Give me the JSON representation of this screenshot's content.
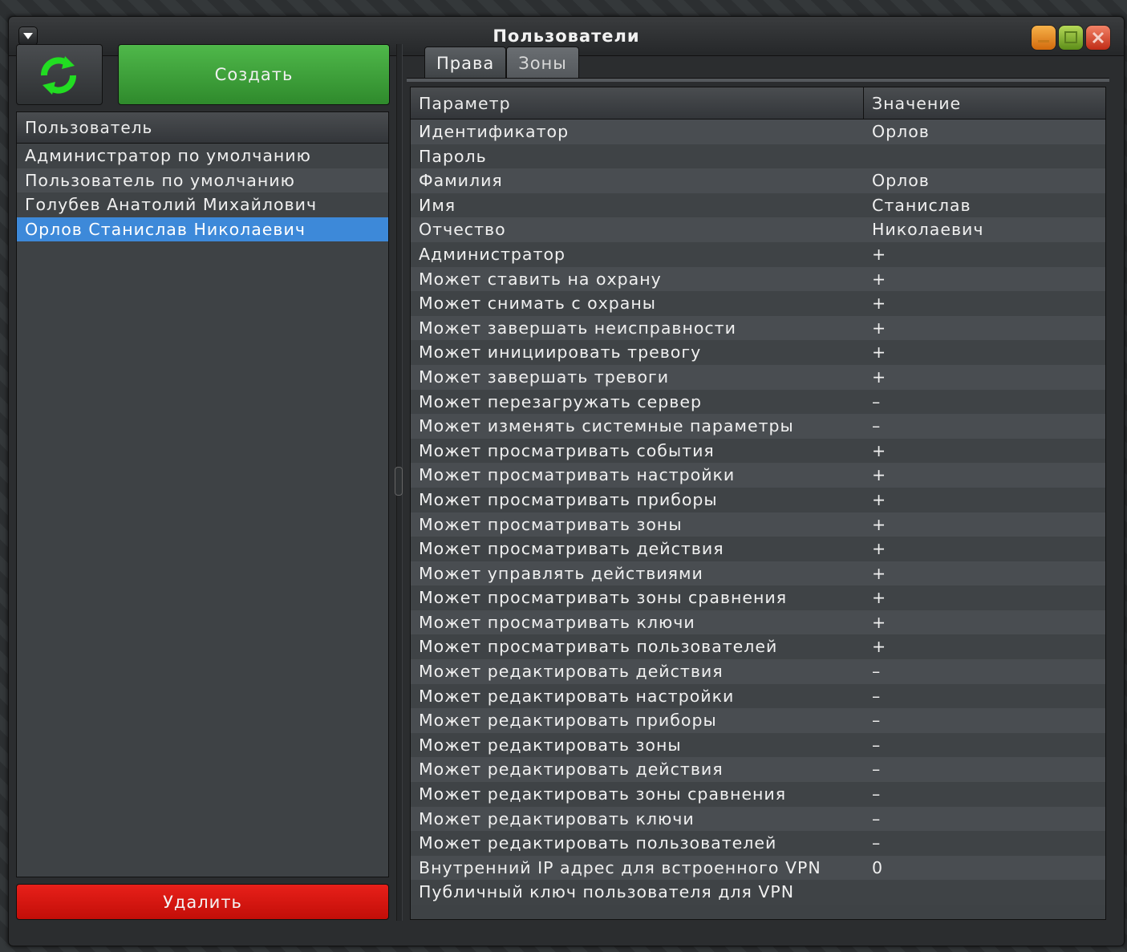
{
  "window": {
    "title": "Пользователи"
  },
  "left": {
    "create_label": "Создать",
    "delete_label": "Удалить",
    "list_header": "Пользователь",
    "users": [
      {
        "name": "Администратор по умолчанию",
        "selected": false
      },
      {
        "name": "Пользователь по умолчанию",
        "selected": false
      },
      {
        "name": "Голубев Анатолий Михайлович",
        "selected": false
      },
      {
        "name": "Орлов Станислав Николаевич",
        "selected": true
      }
    ]
  },
  "right": {
    "tabs": [
      {
        "label": "Права",
        "active": true
      },
      {
        "label": "Зоны",
        "active": false
      }
    ],
    "table": {
      "header_param": "Параметр",
      "header_value": "Значение",
      "rows": [
        {
          "param": "Идентификатор",
          "value": "Орлов"
        },
        {
          "param": "Пароль",
          "value": ""
        },
        {
          "param": "Фамилия",
          "value": "Орлов"
        },
        {
          "param": "Имя",
          "value": "Станислав"
        },
        {
          "param": "Отчество",
          "value": "Николаевич"
        },
        {
          "param": "Администратор",
          "value": "+"
        },
        {
          "param": "Может ставить на охрану",
          "value": "+"
        },
        {
          "param": "Может снимать с охраны",
          "value": "+"
        },
        {
          "param": "Может завершать неисправности",
          "value": "+"
        },
        {
          "param": "Может инициировать тревогу",
          "value": "+"
        },
        {
          "param": "Может завершать тревоги",
          "value": "+"
        },
        {
          "param": "Может перезагружать сервер",
          "value": "–"
        },
        {
          "param": "Может изменять системные параметры",
          "value": "–"
        },
        {
          "param": "Может просматривать события",
          "value": "+"
        },
        {
          "param": "Может просматривать настройки",
          "value": "+"
        },
        {
          "param": "Может просматривать приборы",
          "value": "+"
        },
        {
          "param": "Может просматривать зоны",
          "value": "+"
        },
        {
          "param": "Может просматривать действия",
          "value": "+"
        },
        {
          "param": "Может управлять действиями",
          "value": "+"
        },
        {
          "param": "Может просматривать зоны сравнения",
          "value": "+"
        },
        {
          "param": "Может просматривать ключи",
          "value": "+"
        },
        {
          "param": "Может просматривать пользователей",
          "value": "+"
        },
        {
          "param": "Может редактировать действия",
          "value": "–"
        },
        {
          "param": "Может редактировать настройки",
          "value": "–"
        },
        {
          "param": "Может редактировать приборы",
          "value": "–"
        },
        {
          "param": "Может редактировать зоны",
          "value": "–"
        },
        {
          "param": "Может редактировать действия",
          "value": "–"
        },
        {
          "param": "Может редактировать зоны сравнения",
          "value": "–"
        },
        {
          "param": "Может редактировать ключи",
          "value": "–"
        },
        {
          "param": "Может редактировать пользователей",
          "value": "–"
        },
        {
          "param": "Внутренний IP адрес для встроенного VPN",
          "value": "0"
        },
        {
          "param": "Публичный ключ пользователя для VPN",
          "value": ""
        }
      ]
    }
  },
  "icons": {
    "menu": "dropdown-triangle-icon",
    "refresh": "refresh-icon",
    "minimize": "minimize-icon",
    "maximize": "maximize-icon",
    "close": "close-icon"
  },
  "colors": {
    "create_button": "#3a9e36",
    "delete_button": "#d8140e",
    "selection": "#3d89d9",
    "refresh_icon": "#22dd22"
  }
}
